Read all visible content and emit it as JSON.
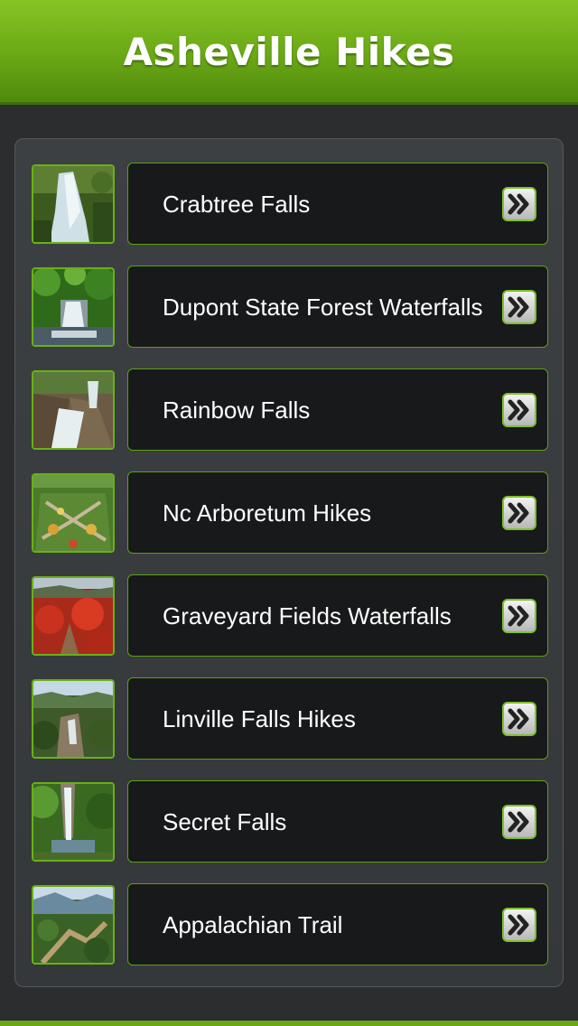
{
  "header": {
    "title": "Asheville Hikes"
  },
  "list": {
    "items": [
      {
        "label": "Crabtree Falls",
        "thumbnail": "waterfall-photo"
      },
      {
        "label": "Dupont State Forest Waterfalls",
        "thumbnail": "forest-waterfall-photo"
      },
      {
        "label": "Rainbow Falls",
        "thumbnail": "rocky-falls-photo"
      },
      {
        "label": "Nc Arboretum Hikes",
        "thumbnail": "garden-photo"
      },
      {
        "label": "Graveyard Fields Waterfalls",
        "thumbnail": "autumn-field-photo"
      },
      {
        "label": "Linville Falls Hikes",
        "thumbnail": "gorge-photo"
      },
      {
        "label": "Secret Falls",
        "thumbnail": "hidden-waterfall-photo"
      },
      {
        "label": "Appalachian Trail",
        "thumbnail": "mountain-valley-photo"
      }
    ]
  },
  "colors": {
    "header_green": "#6aa816",
    "accent_border": "#5aa018",
    "item_background": "#18191b",
    "panel_background": "#3a3d40",
    "page_background": "#2b2d2f"
  },
  "icons": {
    "row_arrow": "double-chevron-right-icon"
  }
}
